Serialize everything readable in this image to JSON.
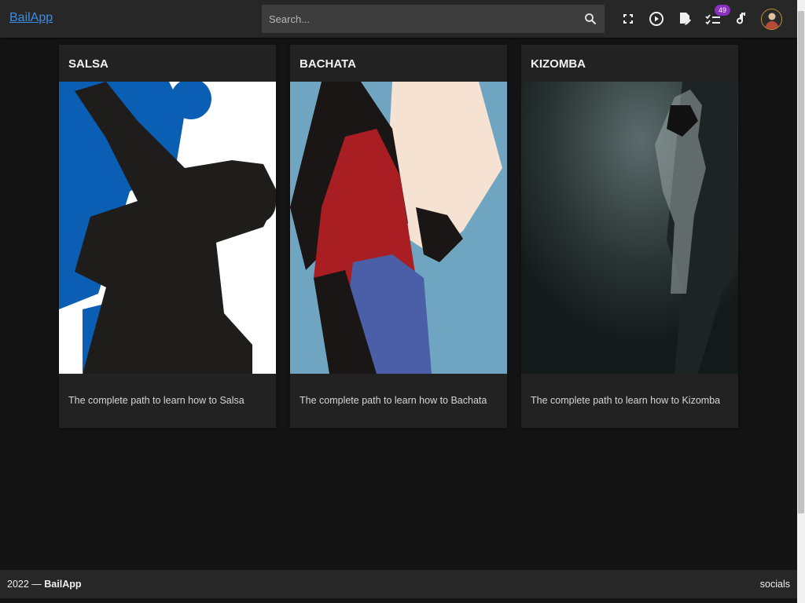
{
  "header": {
    "brand": "BailApp",
    "search": {
      "placeholder": "Search...",
      "value": ""
    },
    "notification_count": "49",
    "icons": [
      "fullscreen-icon",
      "play-circle-icon",
      "edit-note-icon",
      "checklist-icon",
      "music-note-icon"
    ]
  },
  "cards": [
    {
      "title": "SALSA",
      "description": "The complete path to learn how to Salsa"
    },
    {
      "title": "BACHATA",
      "description": "The complete path to learn how to Bachata"
    },
    {
      "title": "KIZOMBA",
      "description": "The complete path to learn how to Kizomba"
    }
  ],
  "footer": {
    "year": "2022 —",
    "brand": "BailApp",
    "socials": "socials"
  },
  "colors": {
    "background": "#141414",
    "surface": "#222222",
    "header": "#272727",
    "link": "#3a8ee6",
    "badge": "#8a2fc0"
  }
}
